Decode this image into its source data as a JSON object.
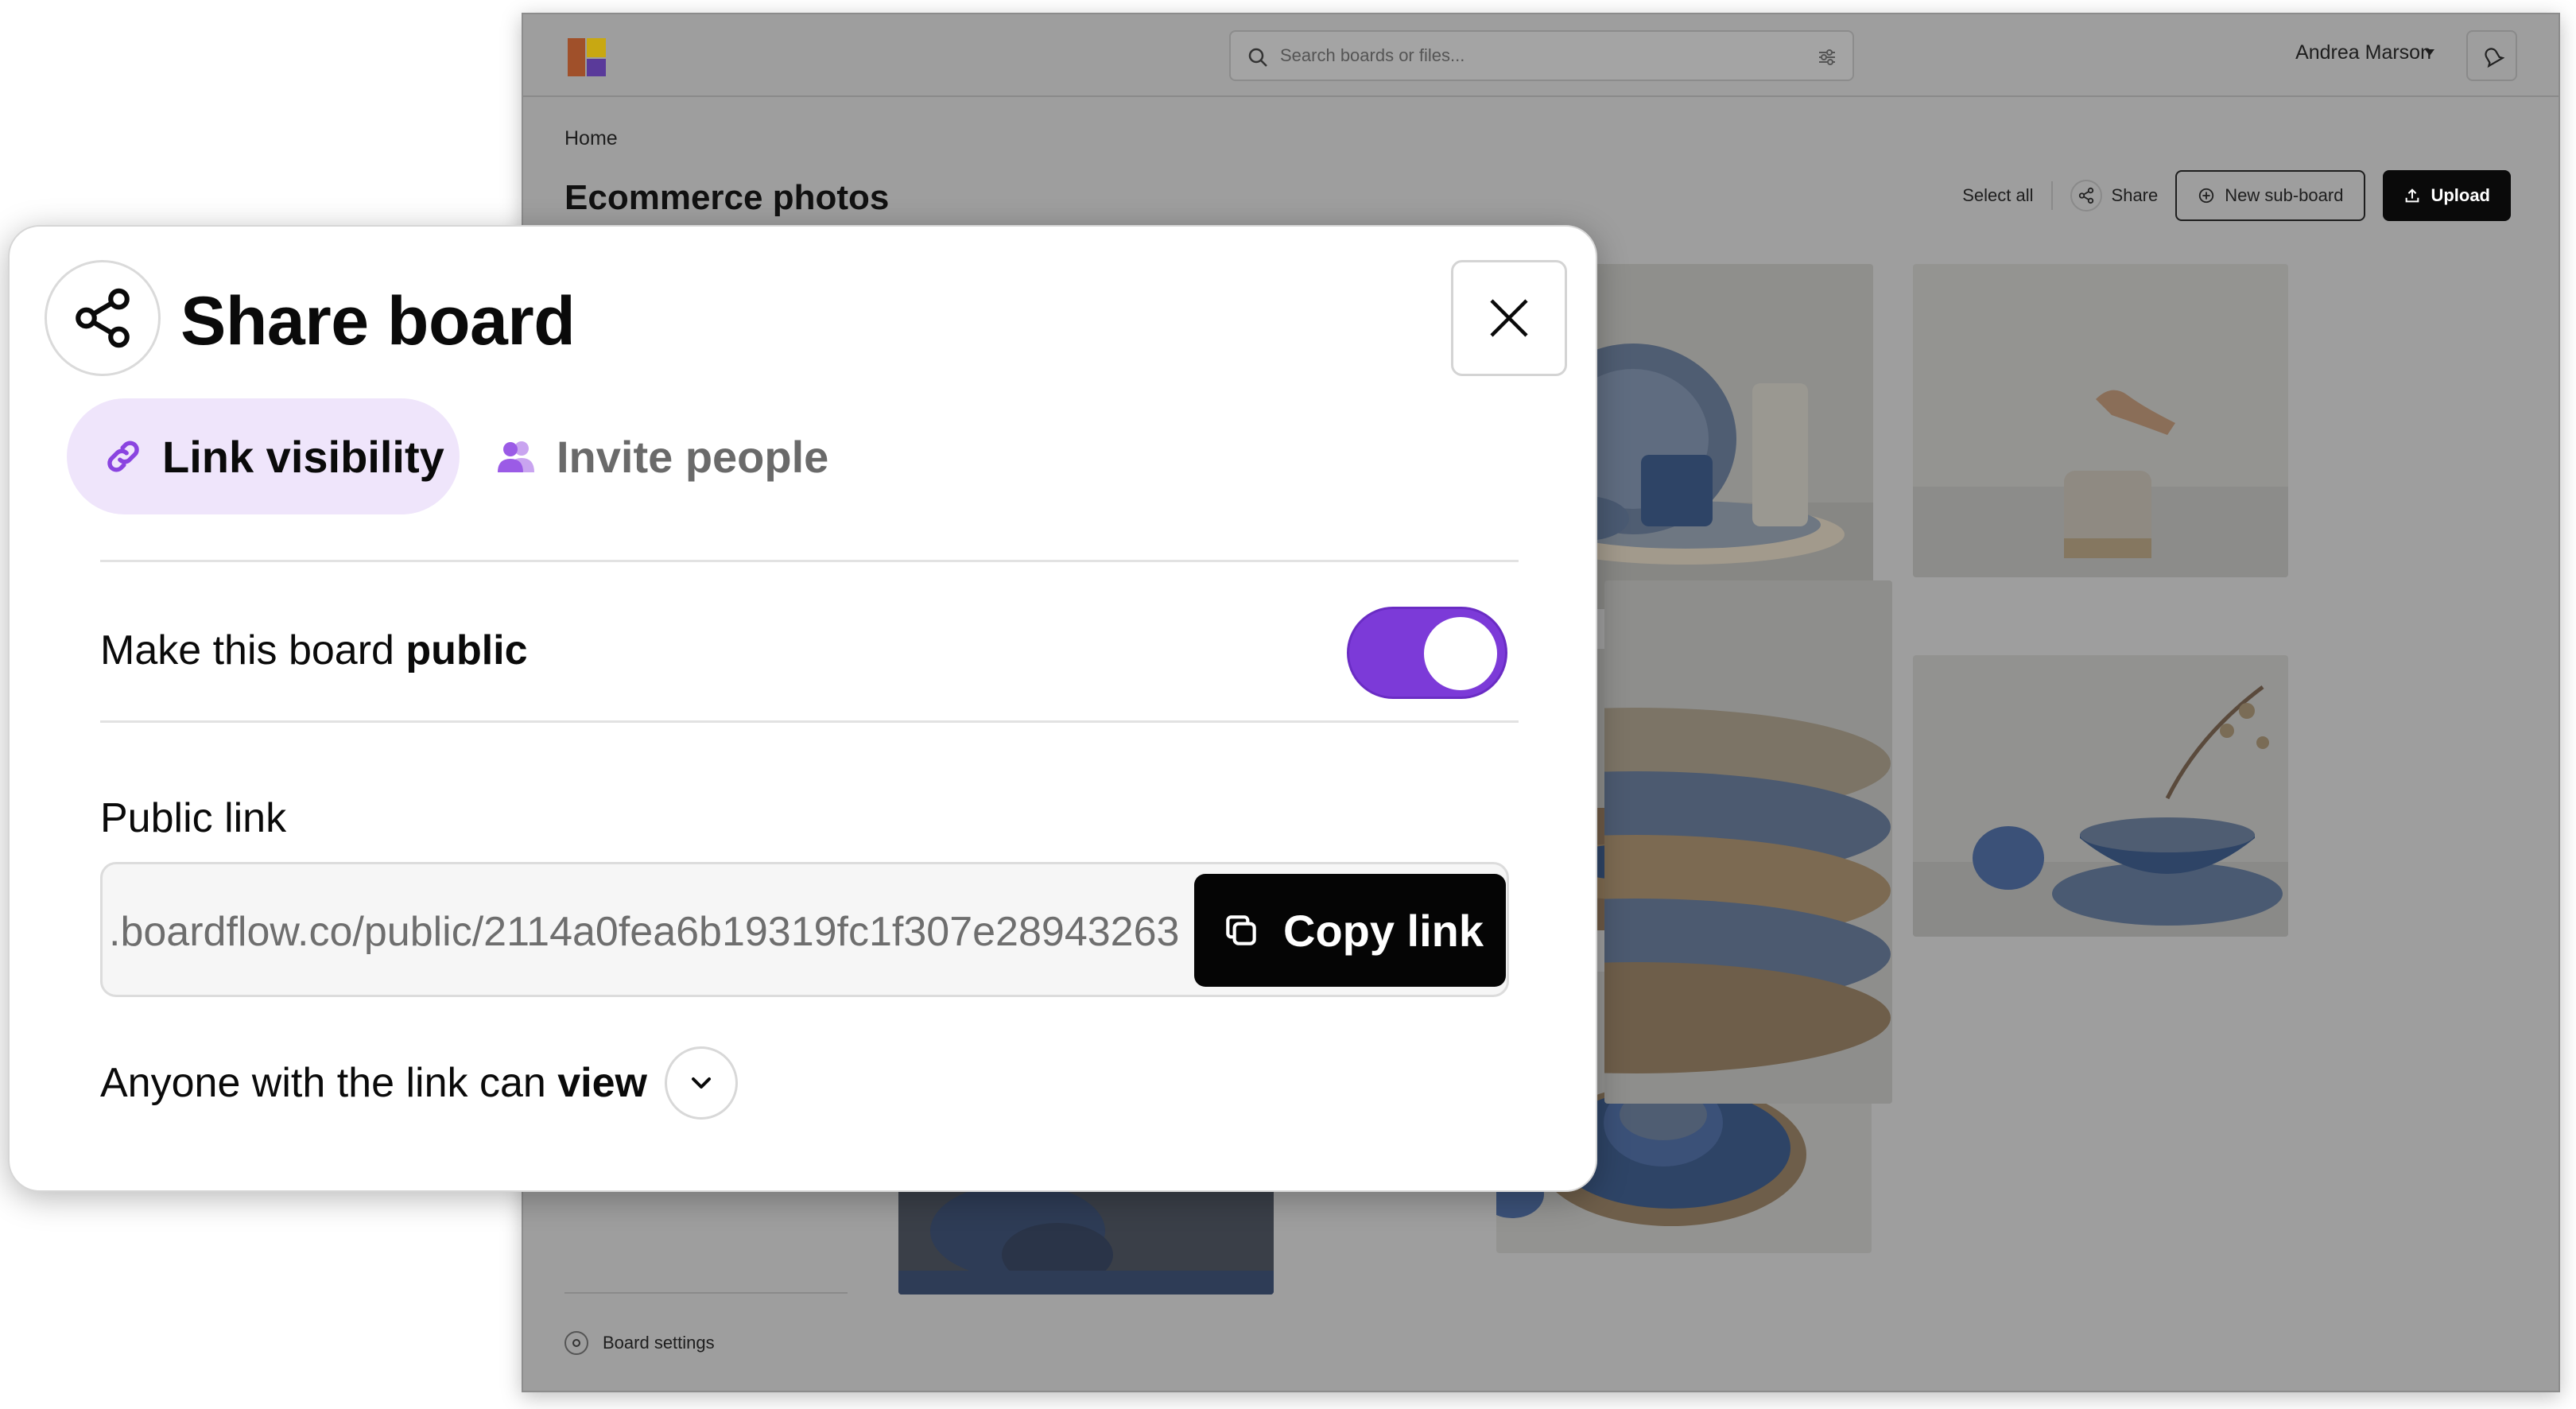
{
  "app": {
    "search_placeholder": "Search boards or files...",
    "user_name": "Andrea Marson",
    "breadcrumb": "Home",
    "board_title": "Ecommerce photos",
    "actions": {
      "select_all": "Select all",
      "share": "Share",
      "new_sub_board": "New sub-board",
      "upload": "Upload"
    },
    "sidebar": {
      "board_settings": "Board settings"
    }
  },
  "modal": {
    "title": "Share board",
    "tabs": [
      {
        "label": "Link visibility",
        "active": true
      },
      {
        "label": "Invite people",
        "active": false
      }
    ],
    "public_toggle": {
      "label_prefix": "Make this board",
      "label_bold": "public",
      "enabled": true
    },
    "public_link": {
      "label": "Public link",
      "url": ".boardflow.co/public/2114a0fea6b19319fc1f307e28943263",
      "copy_label": "Copy link"
    },
    "permission": {
      "prefix": "Anyone with the link can",
      "value": "view"
    }
  },
  "colors": {
    "accent": "#7c3ad8",
    "tab_active_bg": "#efe5fb",
    "dim_overlay": "#9e9e9e"
  }
}
